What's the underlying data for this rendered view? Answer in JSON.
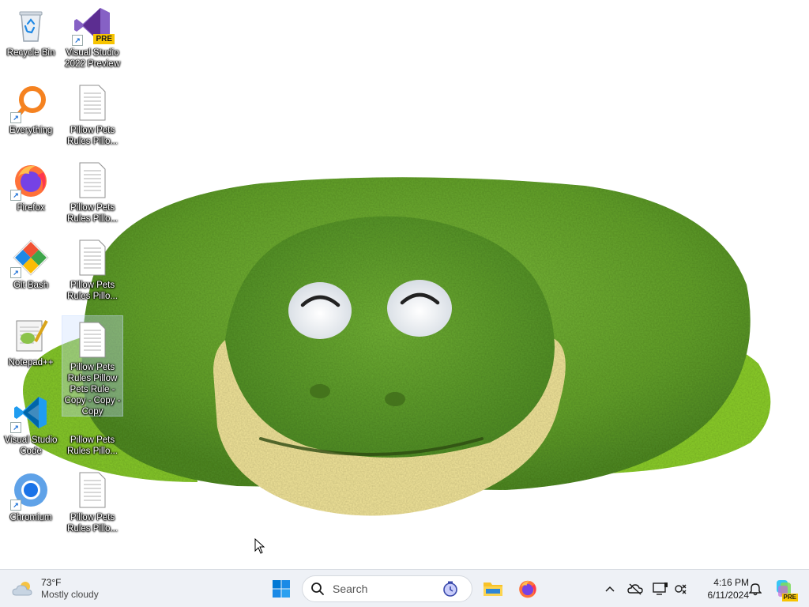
{
  "desktop": {
    "icons": [
      {
        "label": "Recycle Bin",
        "icon": "recycle-bin-icon"
      },
      {
        "label": "Visual Studio 2022 Preview",
        "icon": "visual-studio-preview-icon",
        "badge": "PRE"
      },
      {
        "label": "Everything",
        "icon": "everything-search-icon"
      },
      {
        "label": "Pillow Pets Rules  Pillo...",
        "icon": "text-file-icon"
      },
      {
        "label": "Firefox",
        "icon": "firefox-icon"
      },
      {
        "label": "Pillow Pets Rules  Pillo...",
        "icon": "text-file-icon"
      },
      {
        "label": "Git Bash",
        "icon": "git-bash-icon"
      },
      {
        "label": "Pillow Pets Rules  Pillo...",
        "icon": "text-file-icon"
      },
      {
        "label": "Notepad++",
        "icon": "notepad-plus-plus-icon"
      },
      {
        "label": "Pillow Pets Rules  Pillow Pets Rule - Copy - Copy - Copy",
        "icon": "text-file-icon"
      },
      {
        "label": "Visual Studio Code",
        "icon": "vscode-icon"
      },
      {
        "label": "Pillow Pets Rules  Pillo...",
        "icon": "text-file-icon"
      },
      {
        "label": "Chromium",
        "icon": "chromium-icon"
      },
      {
        "label": "Pillow Pets Rules  Pillo...",
        "icon": "text-file-icon"
      }
    ]
  },
  "taskbar": {
    "weather": {
      "temp": "73°F",
      "condition": "Mostly cloudy",
      "icon": "cloud-icon"
    },
    "start_icon": "windows-start-icon",
    "search": {
      "placeholder": "Search"
    },
    "pinned": [
      {
        "name": "file-explorer-icon"
      },
      {
        "name": "firefox-icon"
      }
    ],
    "tray": [
      "chevron-up-icon",
      "onedrive-offline-icon",
      "display-icon",
      "network-icon"
    ],
    "clock": {
      "time": "4:16 PM",
      "date": "6/11/2024"
    },
    "notification_icon": "bell-icon",
    "copilot_badge": "PRE"
  },
  "colors": {
    "taskbar_bg": "#eef1f6",
    "accent": "#0067c0",
    "frog_green": "#6fae2f",
    "frog_light_green": "#8ccf2a",
    "frog_yellow": "#f2e59a"
  }
}
